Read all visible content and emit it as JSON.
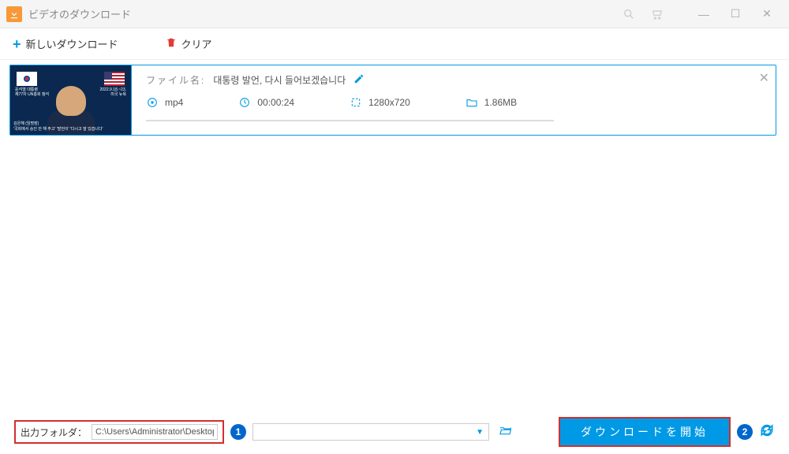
{
  "window": {
    "title": "ビデオのダウンロード"
  },
  "toolbar": {
    "new_download": "新しいダウンロード",
    "clear": "クリア"
  },
  "item": {
    "filename_label": "ファイル名:",
    "filename_value": "대통령 발언, 다시 들어보겠습니다",
    "format": "mp4",
    "duration": "00:00:24",
    "resolution": "1280x720",
    "size": "1.86MB"
  },
  "thumb": {
    "left1": "윤석열 대통령",
    "left2": "제77차 UN총회 참석",
    "right1": "2022.9.18.~23.",
    "right2": "미국 뉴욕",
    "name": "김은혜 (임명장)",
    "caption": "'국회에서 승인 안 해 주고' '발언이' '다시고 말 있습니다'"
  },
  "bottom": {
    "output_label": "出力フォルダ：",
    "output_path": "C:\\Users\\Administrator\\Desktop",
    "annotation1": "1",
    "annotation2": "2",
    "start_download": "ダウンロードを開始"
  }
}
